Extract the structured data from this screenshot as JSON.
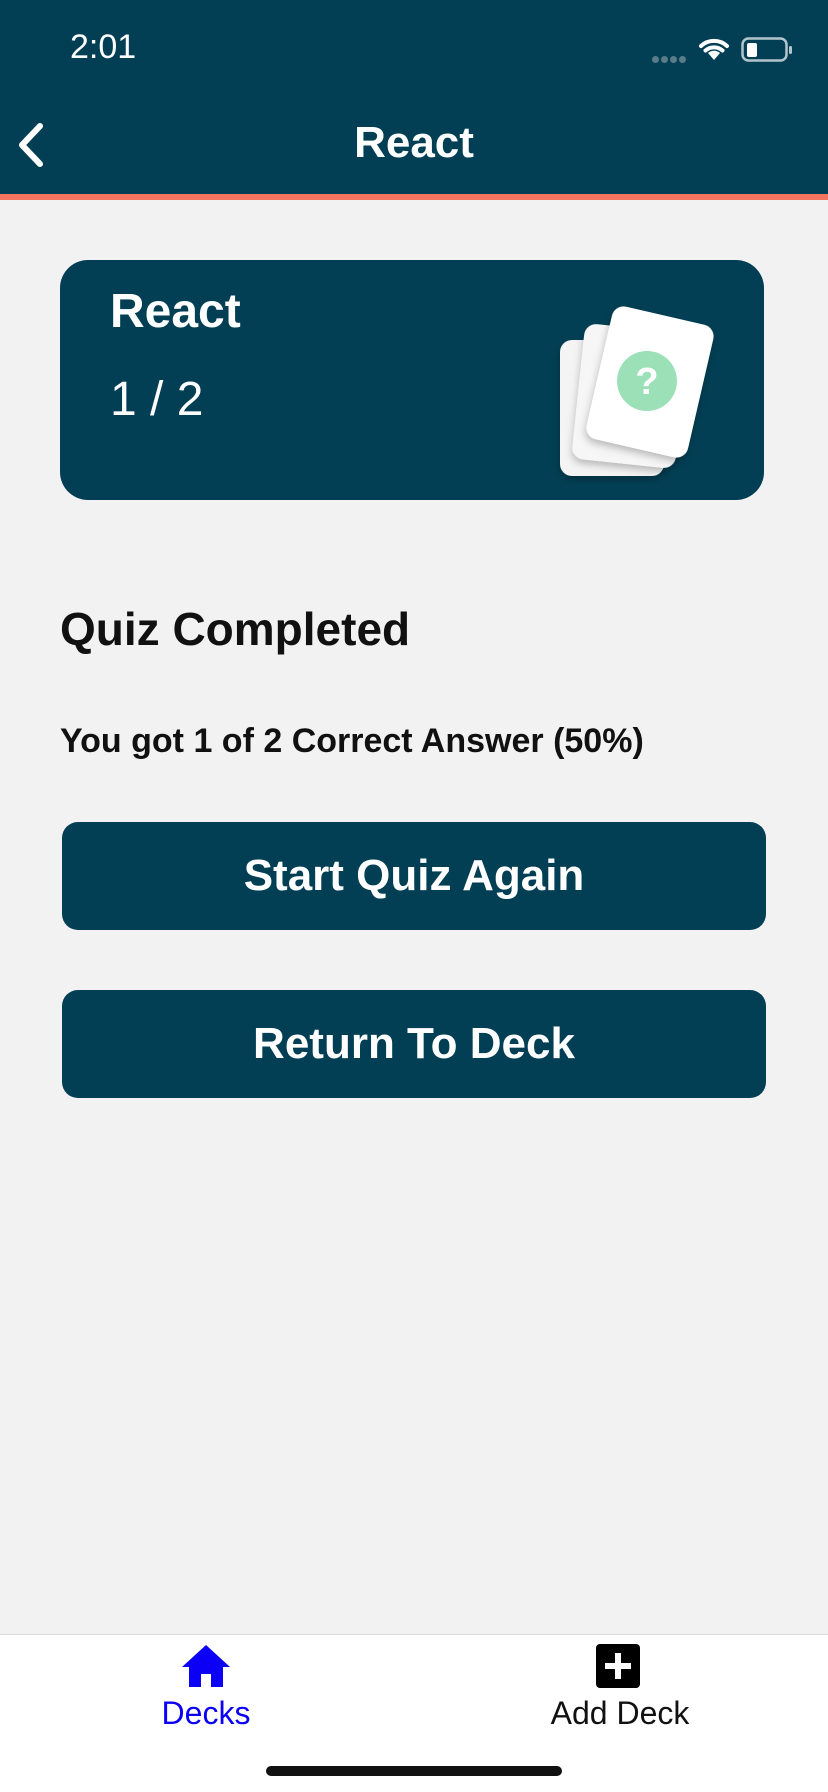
{
  "status_bar": {
    "time": "2:01"
  },
  "nav": {
    "title": "React",
    "back_icon": "chevron-left-icon"
  },
  "deck_card": {
    "name": "React",
    "progress": "1 / 2",
    "icon": "question-cards-icon"
  },
  "result": {
    "title": "Quiz Completed",
    "score_text": "You got 1 of 2 Correct Answer (50%)"
  },
  "buttons": {
    "restart": "Start Quiz Again",
    "return": "Return To Deck"
  },
  "tabs": [
    {
      "label": "Decks",
      "icon": "home-icon",
      "active": true
    },
    {
      "label": "Add Deck",
      "icon": "add-box-icon",
      "active": false
    }
  ],
  "colors": {
    "primary": "#023f54",
    "accent_border": "#f4735f",
    "active_tab": "#0b00f5",
    "background": "#f2f2f2",
    "question_badge": "#9be0b6"
  }
}
